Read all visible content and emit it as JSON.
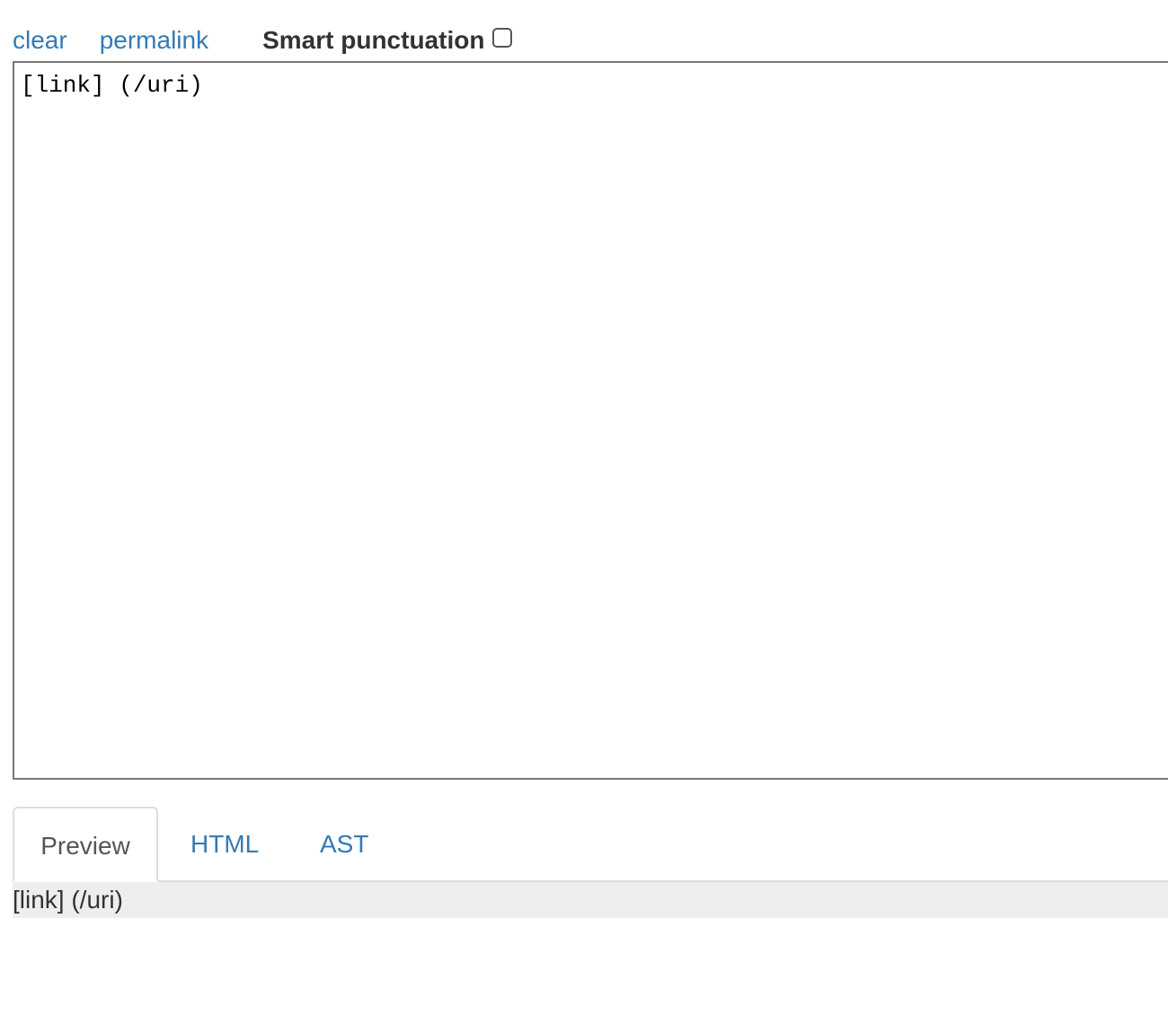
{
  "toolbar": {
    "clear_label": "clear",
    "permalink_label": "permalink",
    "smart_punctuation_label": "Smart punctuation",
    "smart_punctuation_checked": false
  },
  "editor": {
    "value": "[link] (/uri)"
  },
  "tabs": [
    {
      "label": "Preview",
      "active": true
    },
    {
      "label": "HTML",
      "active": false
    },
    {
      "label": "AST",
      "active": false
    }
  ],
  "preview": {
    "text": "[link] (/uri)"
  },
  "colors": {
    "link": "#337ab7",
    "preview_background": "#eeeeee"
  }
}
